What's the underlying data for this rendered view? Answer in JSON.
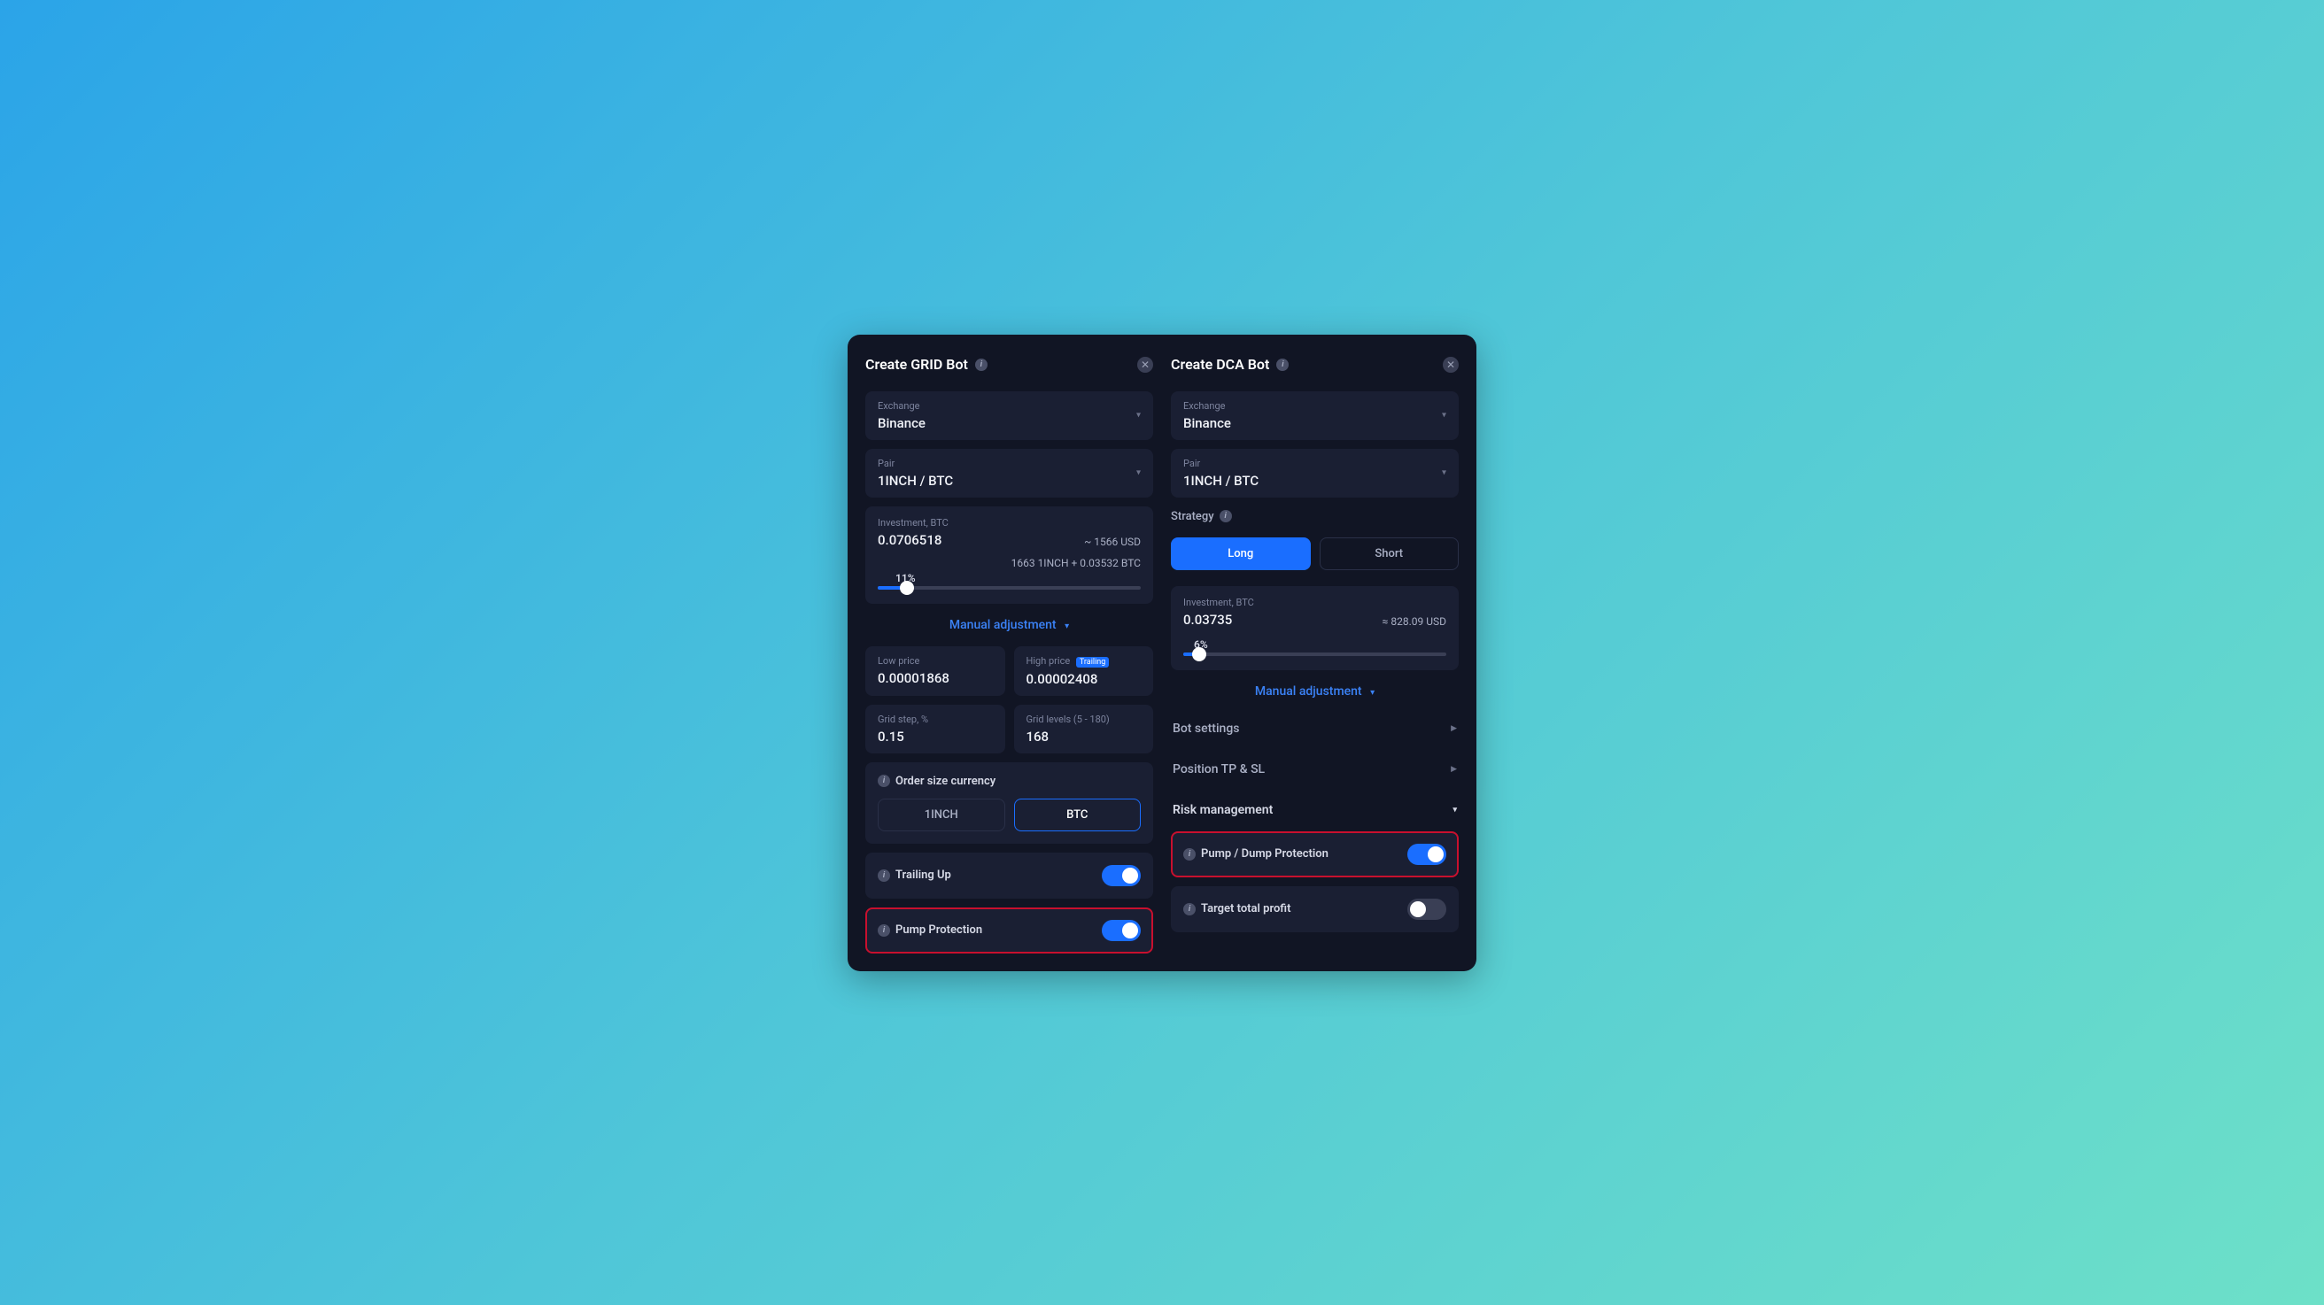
{
  "grid": {
    "title": "Create GRID Bot",
    "exchange_label": "Exchange",
    "exchange_value": "Binance",
    "pair_label": "Pair",
    "pair_value": "1INCH / BTC",
    "investment_label": "Investment, BTC",
    "investment_value": "0.0706518",
    "investment_usd": "~ 1566 USD",
    "breakdown": "1663 1INCH + 0.03532 BTC",
    "slider_percent": "11%",
    "manual_adjustment": "Manual adjustment",
    "low_price_label": "Low price",
    "low_price_value": "0.00001868",
    "high_price_label": "High price",
    "trailing_badge": "Trailing",
    "high_price_value": "0.00002408",
    "grid_step_label": "Grid step, %",
    "grid_step_value": "0.15",
    "grid_levels_label": "Grid levels (5 - 180)",
    "grid_levels_value": "168",
    "order_size_label": "Order size currency",
    "currency_a": "1INCH",
    "currency_b": "BTC",
    "trailing_up": "Trailing Up",
    "pump_protection": "Pump Protection"
  },
  "dca": {
    "title": "Create DCA Bot",
    "exchange_label": "Exchange",
    "exchange_value": "Binance",
    "pair_label": "Pair",
    "pair_value": "1INCH / BTC",
    "strategy_label": "Strategy",
    "strategy_long": "Long",
    "strategy_short": "Short",
    "investment_label": "Investment, BTC",
    "investment_value": "0.03735",
    "investment_usd": "≈ 828.09 USD",
    "slider_percent": "6%",
    "manual_adjustment": "Manual adjustment",
    "bot_settings": "Bot settings",
    "position_tpsl": "Position TP & SL",
    "risk_management": "Risk management",
    "pump_dump_protection": "Pump / Dump Protection",
    "target_total_profit": "Target total profit"
  }
}
